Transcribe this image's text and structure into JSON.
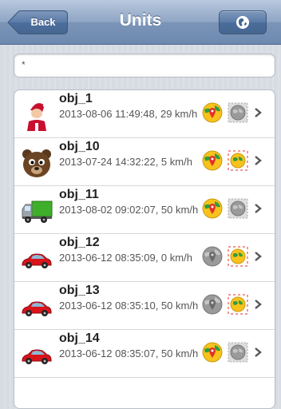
{
  "navbar": {
    "title": "Units",
    "back_label": "Back",
    "world_icon": "globe-icon"
  },
  "search": {
    "value": "*"
  },
  "units": [
    {
      "name": "obj_1",
      "detail": "2013-08-06 11:49:48, 29 km/h",
      "avatar": "santa-avatar",
      "pin_active": true,
      "map_active": false
    },
    {
      "name": "obj_10",
      "detail": "2013-07-24 14:32:22, 5 km/h",
      "avatar": "bear-avatar",
      "pin_active": true,
      "map_active": true
    },
    {
      "name": "obj_11",
      "detail": "2013-08-02 09:02:07, 50 km/h",
      "avatar": "truck-avatar",
      "pin_active": true,
      "map_active": false
    },
    {
      "name": "obj_12",
      "detail": "2013-06-12 08:35:09, 0 km/h",
      "avatar": "car-avatar",
      "pin_active": false,
      "map_active": true
    },
    {
      "name": "obj_13",
      "detail": "2013-06-12 08:35:10, 50 km/h",
      "avatar": "car-avatar",
      "pin_active": false,
      "map_active": true
    },
    {
      "name": "obj_14",
      "detail": "2013-06-12 08:35:07, 50 km/h",
      "avatar": "car-avatar",
      "pin_active": true,
      "map_active": false
    }
  ],
  "colors": {
    "navbar": "#7b95b8",
    "pin_active": "#f7c21c",
    "pin_inactive": "#9a9a9a",
    "car": "#d9141b"
  }
}
